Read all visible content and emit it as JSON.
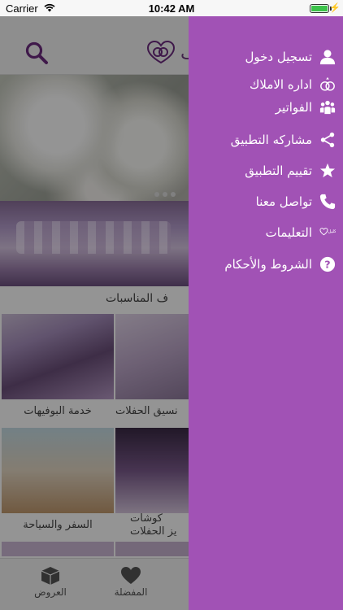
{
  "status_bar": {
    "carrier": "Carrier",
    "time": "10:42 AM"
  },
  "drawer": {
    "background_color": "#a152b5",
    "items": [
      {
        "label": "تسجيل دخول",
        "icon": "user-icon"
      },
      {
        "label": "اداره الاملاك",
        "icon": "rings-icon"
      },
      {
        "label": "الفواتير",
        "icon": "group-icon"
      },
      {
        "label": "مشاركه التطبيق",
        "icon": "share-icon"
      },
      {
        "label": "تقييم التطبيق",
        "icon": "star-icon"
      },
      {
        "label": "تواصل معنا",
        "icon": "phone-icon"
      },
      {
        "label": "التعليمات",
        "icon": "brand-logo-icon"
      },
      {
        "label": "الشروط والأحكام",
        "icon": "help-icon"
      }
    ]
  },
  "background_app": {
    "title_partial": "ف",
    "section_label": "ف المناسبات",
    "tiles": [
      {
        "caption": "خدمة البوفيهات"
      },
      {
        "caption": "نسيق الحفلات"
      },
      {
        "caption": "السفر والسياحة"
      },
      {
        "caption": "كوشات\nيز الحفلات"
      }
    ],
    "tabs": [
      {
        "label": "العروض",
        "icon": "box-icon"
      },
      {
        "label": "المفضلة",
        "icon": "heart-icon"
      }
    ]
  }
}
